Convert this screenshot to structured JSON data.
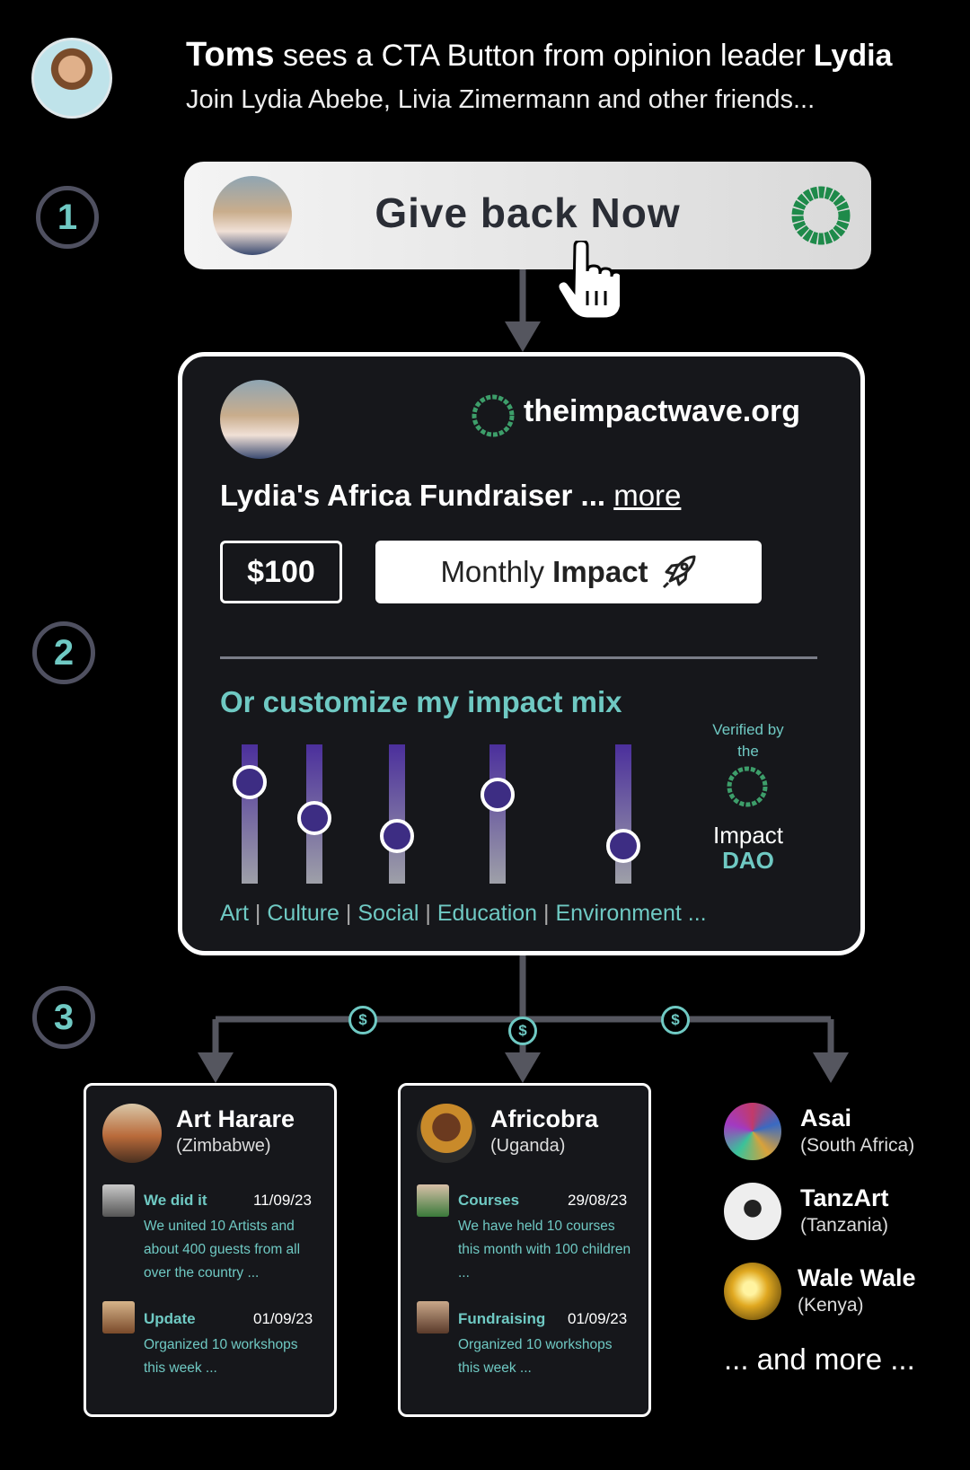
{
  "header": {
    "viewer_name": "Toms",
    "middle_text": "sees a CTA Button from opinion leader",
    "leader_name": "Lydia",
    "subtitle": "Join Lydia Abebe, Livia Zimermann and other friends..."
  },
  "steps": [
    "1",
    "2",
    "3"
  ],
  "cta": {
    "label": "Give back Now"
  },
  "card": {
    "domain": "theimpactwave.org",
    "fundraiser_title": "Lydia's Africa Fundraiser ...",
    "more_link": "more",
    "amount": "$100",
    "monthly_prefix": "Monthly",
    "monthly_bold": "Impact",
    "mix_title": "Or customize my impact mix",
    "sliders": [
      {
        "level": 0.73
      },
      {
        "level": 0.47
      },
      {
        "level": 0.34
      },
      {
        "level": 0.64
      },
      {
        "level": 0.27
      }
    ],
    "categories": [
      "Art",
      "Culture",
      "Social",
      "Education",
      "Environment ..."
    ],
    "verified_line1": "Verified by",
    "verified_line2": "the",
    "dao_line1": "Impact",
    "dao_line2": "DAO"
  },
  "coin_symbol": "$",
  "orgs": [
    {
      "name": "Art Harare",
      "country": "(Zimbabwe)",
      "posts": [
        {
          "title": "We did it",
          "date": "11/09/23",
          "body": "We united 10 Artists and about 400 guests from all over the country ..."
        },
        {
          "title": "Update",
          "date": "01/09/23",
          "body": "Organized 10 workshops this week ..."
        }
      ]
    },
    {
      "name": "Africobra",
      "country": "(Uganda)",
      "posts": [
        {
          "title": "Courses",
          "date": "29/08/23",
          "body": "We have held 10 courses this month with 100 children ..."
        },
        {
          "title": "Fundraising",
          "date": "01/09/23",
          "body": "Organized 10 workshops this week ..."
        }
      ]
    }
  ],
  "side_orgs": [
    {
      "name": "Asai",
      "country": "(South Africa)"
    },
    {
      "name": "TanzArt",
      "country": "(Tanzania)"
    },
    {
      "name": "Wale Wale",
      "country": "(Kenya)"
    }
  ],
  "and_more": "... and more ...",
  "colors": {
    "accent": "#6fc9c3",
    "green_logo": "#1e8a4a",
    "slider_top": "#4b2f9c",
    "step_ring": "#4f5060"
  }
}
